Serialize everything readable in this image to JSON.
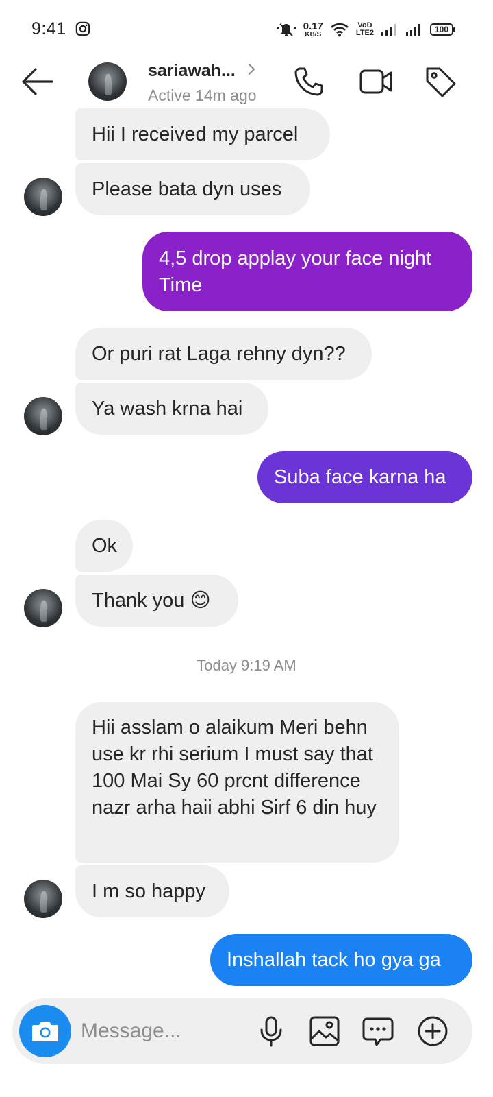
{
  "status_bar": {
    "time": "9:41",
    "net_speed_value": "0.17",
    "net_speed_unit": "KB/S",
    "volte_top": "VoD",
    "volte_bottom": "LTE2",
    "battery": "100"
  },
  "header": {
    "name": "sariawah...",
    "status": "Active 14m ago"
  },
  "messages": [
    {
      "text": "Hii I received my parcel"
    },
    {
      "text": "Please bata dyn uses"
    },
    {
      "text": "4,5 drop applay your face night Time"
    },
    {
      "text": "Or puri rat Laga rehny dyn??"
    },
    {
      "text": "Ya wash krna hai"
    },
    {
      "text": "Suba face karna ha"
    },
    {
      "text": "Ok"
    },
    {
      "text": "Thank you 😊"
    },
    {
      "text": "Hii asslam o alaikum Meri behn use kr rhi serium I must say that 100 Mai Sy 60 prcnt difference nazr arha haii abhi Sirf 6 din huy"
    },
    {
      "text": "I m so happy"
    },
    {
      "text": "Inshallah tack ho gya ga"
    }
  ],
  "time_divider": "Today 9:19 AM",
  "composer": {
    "placeholder": "Message..."
  },
  "colors": {
    "outgoing_1": "#8b21c8",
    "outgoing_2": "#6a34d6",
    "outgoing_3": "#1a82f2",
    "incoming": "#efefef",
    "camera": "#1a8cf0"
  }
}
